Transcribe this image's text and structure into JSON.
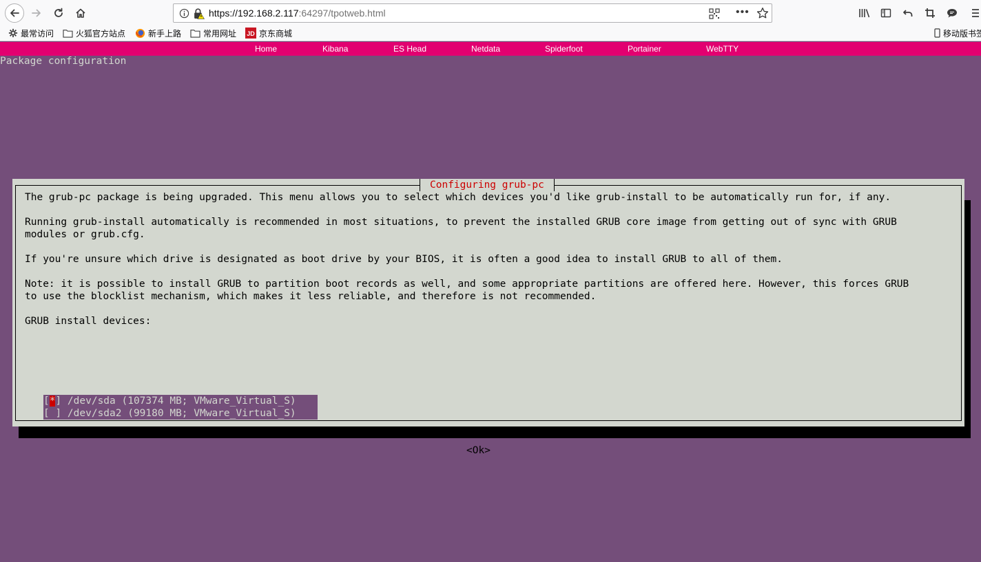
{
  "browser": {
    "url_host": "https://192.168.2.117",
    "url_rest": ":64297/tpotweb.html",
    "bookmarks": [
      {
        "label": "最常访问",
        "icon": "gear-icon"
      },
      {
        "label": "火狐官方站点",
        "icon": "folder-icon"
      },
      {
        "label": "新手上路",
        "icon": "firefox-icon"
      },
      {
        "label": "常用网址",
        "icon": "folder-icon"
      },
      {
        "label": "京东商城",
        "icon": "jd-icon"
      }
    ],
    "mobile_bookmarks": "移动版书签"
  },
  "tpot_nav": [
    "Home",
    "Kibana",
    "ES Head",
    "Netdata",
    "Spiderfoot",
    "Portainer",
    "WebTTY"
  ],
  "terminal": {
    "header": "Package configuration",
    "dialog_title": "Configuring grub-pc",
    "paragraphs": [
      "The grub-pc package is being upgraded. This menu allows you to select which devices you'd like grub-install to be automatically run for, if any.",
      "Running grub-install automatically is recommended in most situations, to prevent the installed GRUB core image from getting out of sync with GRUB",
      "modules or grub.cfg.",
      "If you're unsure which drive is designated as boot drive by your BIOS, it is often a good idea to install GRUB to all of them.",
      "Note: it is possible to install GRUB to partition boot records as well, and some appropriate partitions are offered here. However, this forces GRUB",
      "to use the blocklist mechanism, which makes it less reliable, and therefore is not recommended.",
      "GRUB install devices:"
    ],
    "devices": [
      {
        "open": "[",
        "mark": "*",
        "close": "] /dev/sda (107374 MB; VMware_Virtual_S)"
      },
      {
        "open": "[",
        "mark": " ",
        "close": "] /dev/sda2 (99180 MB; VMware_Virtual_S)"
      }
    ],
    "ok_label": "<Ok>"
  },
  "colors": {
    "terminal_bg": "#744e7a",
    "dialog_bg": "#d3d7cf",
    "nav_bg": "#e20070",
    "title_red": "#cc0000"
  }
}
